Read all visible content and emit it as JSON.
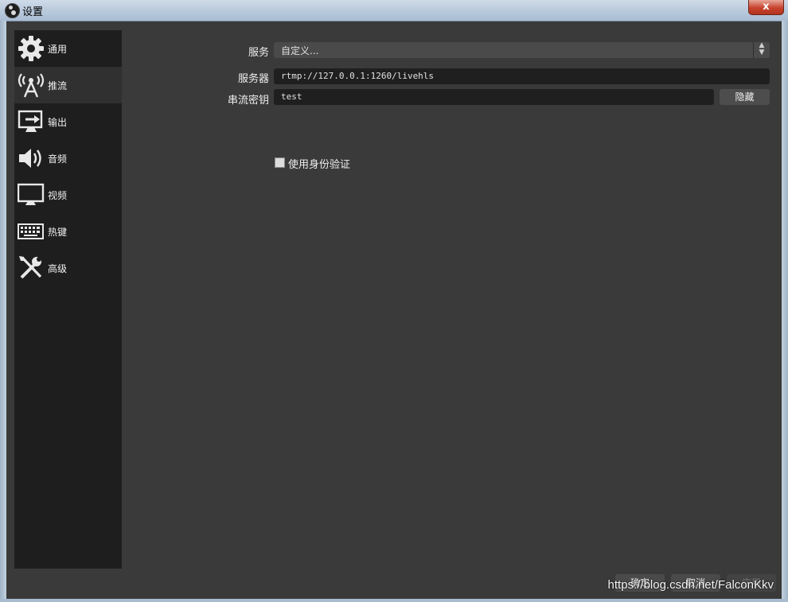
{
  "window": {
    "title": "设置",
    "close_glyph": "x",
    "app_icon": "obs-logo-icon"
  },
  "sidebar": {
    "items": [
      {
        "label": "通用",
        "icon": "gear-icon",
        "active": false
      },
      {
        "label": "推流",
        "icon": "broadcast-tower-icon",
        "active": true
      },
      {
        "label": "输出",
        "icon": "output-monitor-icon",
        "active": false
      },
      {
        "label": "音频",
        "icon": "speaker-icon",
        "active": false
      },
      {
        "label": "视频",
        "icon": "monitor-icon",
        "active": false
      },
      {
        "label": "热键",
        "icon": "keyboard-icon",
        "active": false
      },
      {
        "label": "高级",
        "icon": "wrench-screwdriver-icon",
        "active": false
      }
    ]
  },
  "stream": {
    "service_label": "服务",
    "service_value": "自定义...",
    "server_label": "服务器",
    "server_value": "rtmp://127.0.0.1:1260/livehls",
    "key_label": "串流密钥",
    "key_value": "test",
    "hide_button": "隐藏",
    "auth_checkbox_label": "使用身份验证",
    "auth_checked": false
  },
  "footer": {
    "ok": "确定",
    "cancel": "取消",
    "apply": "应用"
  },
  "watermark": "https://blog.csdn.net/FalconKkv"
}
